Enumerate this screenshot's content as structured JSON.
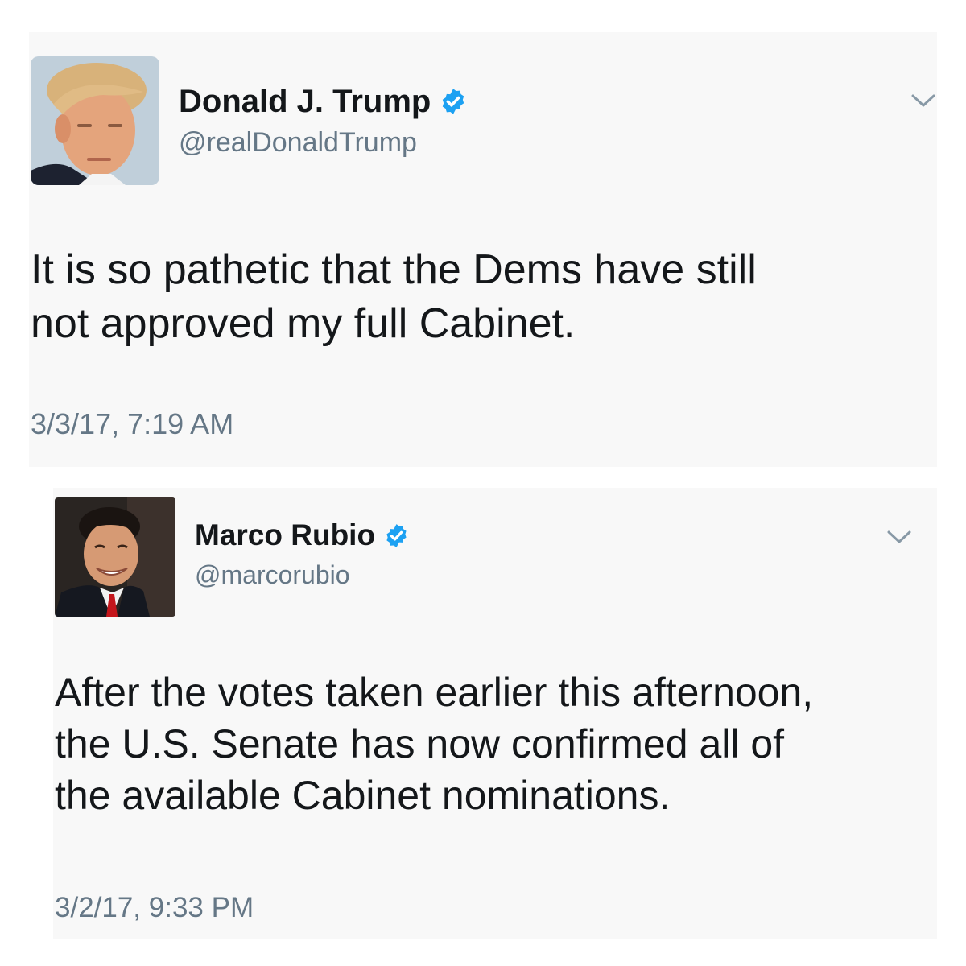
{
  "tweets": [
    {
      "display_name": "Donald J. Trump",
      "handle": "@realDonaldTrump",
      "verified": true,
      "avatar_icon": "avatar-photo",
      "menu_icon": "chevron-down-icon",
      "text_lines": [
        "It is so pathetic that the Dems have still",
        "not approved my full Cabinet."
      ],
      "timestamp": "3/3/17, 7:19 AM"
    },
    {
      "display_name": "Marco Rubio",
      "handle": "@marcorubio",
      "verified": true,
      "avatar_icon": "avatar-photo",
      "menu_icon": "chevron-down-icon",
      "text_lines": [
        "After the votes taken earlier this afternoon,",
        "the U.S. Senate has now confirmed all of",
        "the available Cabinet nominations."
      ],
      "timestamp": "3/2/17, 9:33 PM"
    }
  ],
  "colors": {
    "verified_blue": "#1da1f2",
    "secondary_text": "#657786",
    "primary_text": "#14171a",
    "card_background": "#f8f8f8"
  }
}
